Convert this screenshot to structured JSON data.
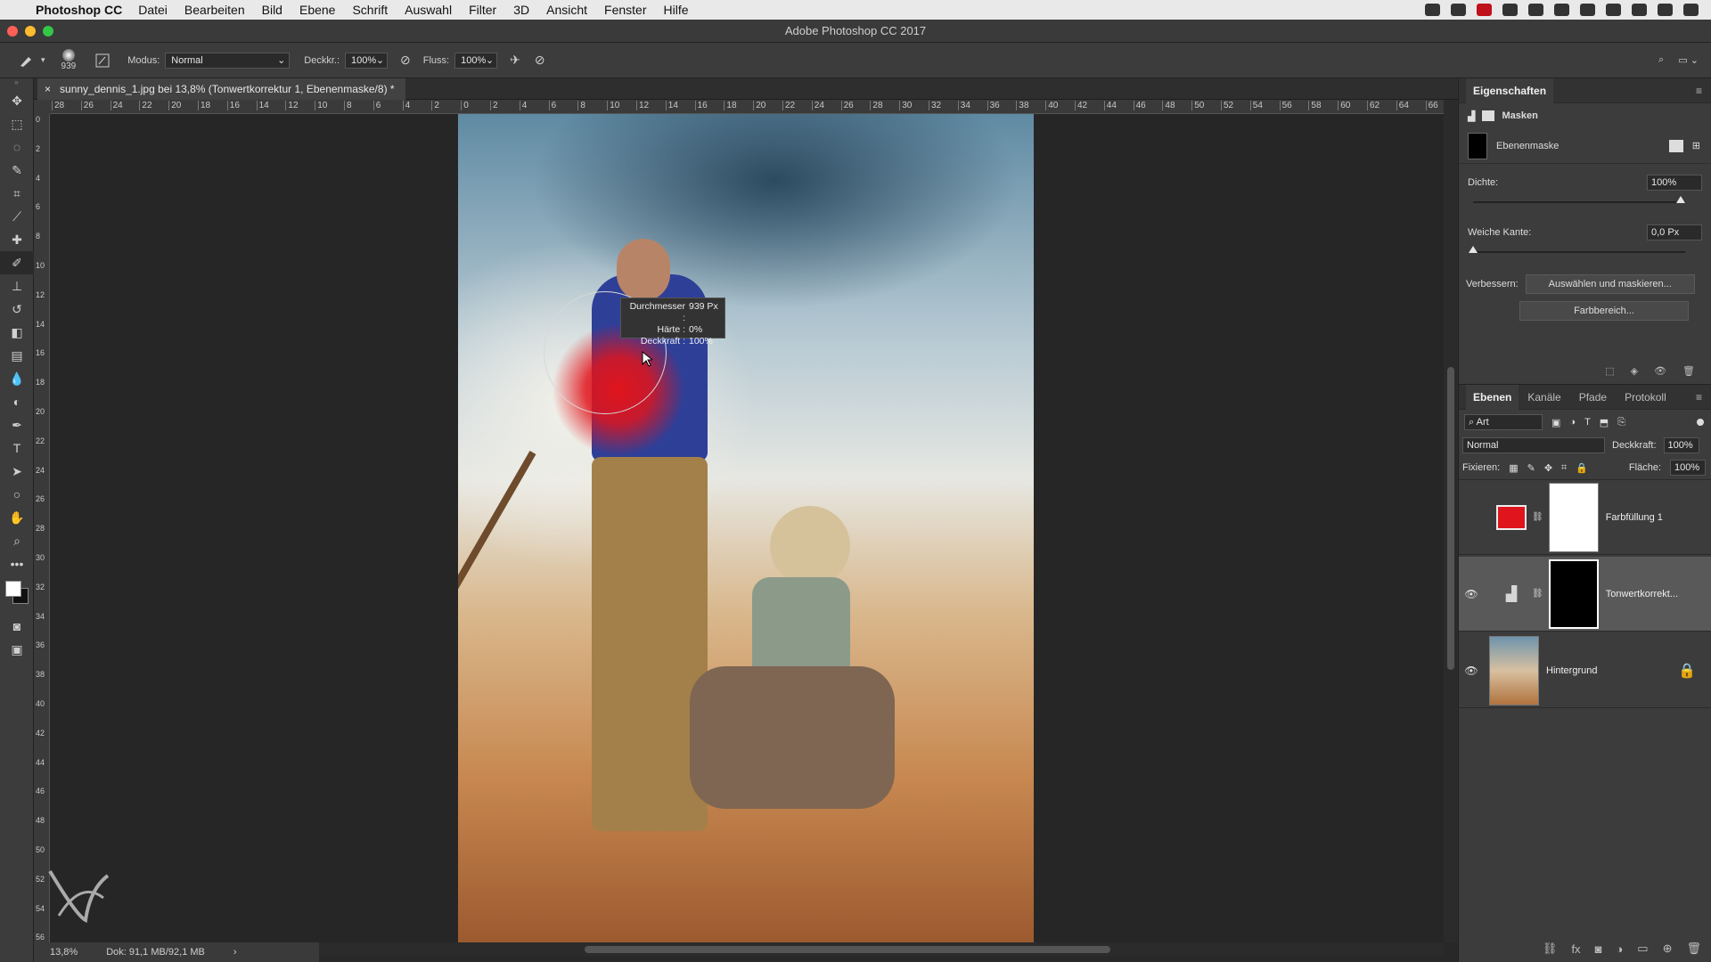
{
  "menubar": {
    "app_name": "Photoshop CC",
    "items": [
      "Datei",
      "Bearbeiten",
      "Bild",
      "Ebene",
      "Schrift",
      "Auswahl",
      "Filter",
      "3D",
      "Ansicht",
      "Fenster",
      "Hilfe"
    ]
  },
  "window": {
    "title": "Adobe Photoshop CC 2017"
  },
  "options_bar": {
    "brush_size": "939",
    "mode_label": "Modus:",
    "mode_value": "Normal",
    "opacity_label": "Deckkr.:",
    "opacity_value": "100%",
    "flow_label": "Fluss:",
    "flow_value": "100%"
  },
  "document": {
    "tab_title": "sunny_dennis_1.jpg bei 13,8% (Tonwertkorrektur 1, Ebenenmaske/8) *",
    "close_glyph": "×"
  },
  "rulers": {
    "h_ticks": [
      "28",
      "26",
      "24",
      "22",
      "20",
      "18",
      "16",
      "14",
      "12",
      "10",
      "8",
      "6",
      "4",
      "2",
      "0",
      "2",
      "4",
      "6",
      "8",
      "10",
      "12",
      "14",
      "16",
      "18",
      "20",
      "22",
      "24",
      "26",
      "28",
      "30",
      "32",
      "34",
      "36",
      "38",
      "40",
      "42",
      "44",
      "46",
      "48",
      "50",
      "52",
      "54",
      "56",
      "58",
      "60",
      "62",
      "64",
      "66"
    ],
    "v_ticks": [
      "0",
      "2",
      "4",
      "6",
      "8",
      "10",
      "12",
      "14",
      "16",
      "18",
      "20",
      "22",
      "24",
      "26",
      "28",
      "30",
      "32",
      "34",
      "36",
      "38",
      "40",
      "42",
      "44",
      "46",
      "48",
      "50",
      "52",
      "54",
      "56"
    ]
  },
  "brush_tooltip": {
    "diameter_label": "Durchmesser :",
    "diameter_value": "939 Px",
    "hardness_label": "Härte :",
    "hardness_value": "0%",
    "opacity_label": "Deckkraft :",
    "opacity_value": "100%"
  },
  "status": {
    "zoom": "13,8%",
    "doc": "Dok: 91,1 MB/92,1 MB",
    "arrow": "›"
  },
  "properties": {
    "panel_title": "Eigenschaften",
    "section": "Masken",
    "mask_name": "Ebenenmaske",
    "density_label": "Dichte:",
    "density_value": "100%",
    "density_level": 1.0,
    "feather_label": "Weiche Kante:",
    "feather_value": "0,0 Px",
    "feather_level": 0.0,
    "refine_label": "Verbessern:",
    "select_mask_button": "Auswählen und maskieren...",
    "color_range_button": "Farbbereich..."
  },
  "layers_panel": {
    "tabs": [
      "Ebenen",
      "Kanäle",
      "Pfade",
      "Protokoll"
    ],
    "filter_kind": "Art",
    "blend_mode": "Normal",
    "opacity_label": "Deckkraft:",
    "opacity_value": "100%",
    "lock_label": "Fixieren:",
    "fill_label": "Fläche:",
    "fill_value": "100%",
    "layers": [
      {
        "name": "Farbfüllung 1",
        "visible": false,
        "swatch_color": "#e0141c",
        "mask": "white"
      },
      {
        "name": "Tonwertkorrekt...",
        "visible": true,
        "selected": true,
        "mask": "black"
      },
      {
        "name": "Hintergrund",
        "visible": true,
        "locked": true
      }
    ]
  },
  "colors": {
    "accent_red": "#e0141c",
    "panel_bg": "#3c3c3c",
    "canvas_bg": "#262626"
  }
}
